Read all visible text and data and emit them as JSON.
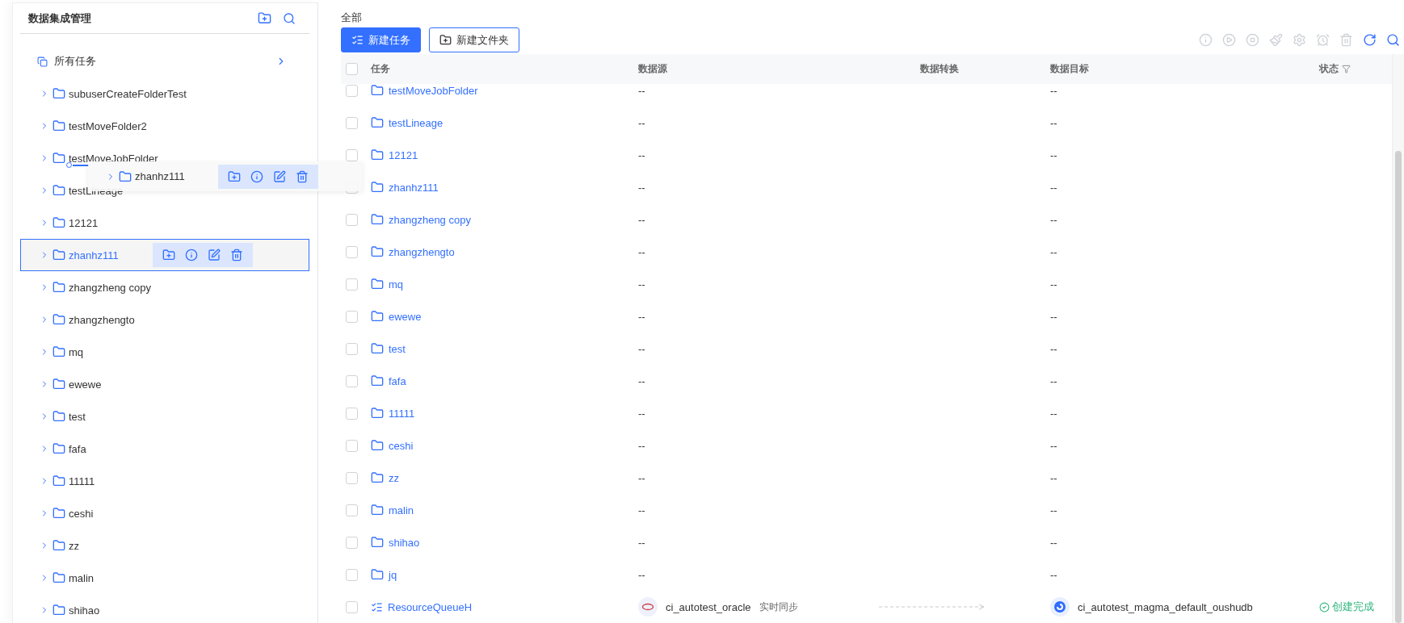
{
  "sidebar": {
    "title": "数据集成管理",
    "all_tasks": {
      "label": "所有任务"
    },
    "items": [
      {
        "label": "subuserCreateFolderTest",
        "selected": false,
        "expanded": false
      },
      {
        "label": "testMoveFolder2",
        "selected": false,
        "expanded": false
      },
      {
        "label": "testMoveJobFolder",
        "selected": false,
        "expanded": false
      },
      {
        "label": "testLineage",
        "selected": false,
        "expanded": false
      },
      {
        "label": "12121",
        "selected": false,
        "expanded": false
      },
      {
        "label": "zhanhz111",
        "selected": true,
        "expanded": false
      },
      {
        "label": "zhangzheng copy",
        "selected": false,
        "expanded": false
      },
      {
        "label": "zhangzhengto",
        "selected": false,
        "expanded": false
      },
      {
        "label": "mq",
        "selected": false,
        "expanded": false
      },
      {
        "label": "ewewe",
        "selected": false,
        "expanded": false
      },
      {
        "label": "test",
        "selected": false,
        "expanded": false
      },
      {
        "label": "fafa",
        "selected": false,
        "expanded": false
      },
      {
        "label": "11111",
        "selected": false,
        "expanded": false
      },
      {
        "label": "ceshi",
        "selected": false,
        "expanded": false
      },
      {
        "label": "zz",
        "selected": false,
        "expanded": false
      },
      {
        "label": "malin",
        "selected": false,
        "expanded": false
      },
      {
        "label": "shihao",
        "selected": false,
        "expanded": false
      }
    ]
  },
  "drag_ghost": {
    "label": "zhanhz111",
    "expanded": false
  },
  "main": {
    "breadcrumb": "全部",
    "buttons": [
      {
        "label": "新建任务",
        "kind": "primary"
      },
      {
        "label": "新建文件夹",
        "kind": "secondary"
      }
    ],
    "toolbar": [
      {
        "disabled": true
      },
      {
        "disabled": true
      },
      {
        "disabled": true
      },
      {
        "disabled": true
      },
      {
        "disabled": true
      },
      {
        "disabled": true
      },
      {
        "disabled": true
      },
      {
        "disabled": false
      },
      {
        "disabled": false
      }
    ]
  },
  "table": {
    "all_checked": false,
    "columns": [
      "任务",
      "数据源",
      "数据转换",
      "数据目标",
      "状态"
    ],
    "rows": [
      {
        "kind": "folder",
        "name": "testMoveJobFolder",
        "checked": false,
        "source": "--",
        "target": "--"
      },
      {
        "kind": "folder",
        "name": "testLineage",
        "checked": false,
        "source": "--",
        "target": "--"
      },
      {
        "kind": "folder",
        "name": "12121",
        "checked": false,
        "source": "--",
        "target": "--"
      },
      {
        "kind": "folder",
        "name": "zhanhz111",
        "checked": false,
        "source": "--",
        "target": "--"
      },
      {
        "kind": "folder",
        "name": "zhangzheng copy",
        "checked": false,
        "source": "--",
        "target": "--"
      },
      {
        "kind": "folder",
        "name": "zhangzhengto",
        "checked": false,
        "source": "--",
        "target": "--"
      },
      {
        "kind": "folder",
        "name": "mq",
        "checked": false,
        "source": "--",
        "target": "--"
      },
      {
        "kind": "folder",
        "name": "ewewe",
        "checked": false,
        "source": "--",
        "target": "--"
      },
      {
        "kind": "folder",
        "name": "test",
        "checked": false,
        "source": "--",
        "target": "--"
      },
      {
        "kind": "folder",
        "name": "fafa",
        "checked": false,
        "source": "--",
        "target": "--"
      },
      {
        "kind": "folder",
        "name": "11111",
        "checked": false,
        "source": "--",
        "target": "--"
      },
      {
        "kind": "folder",
        "name": "ceshi",
        "checked": false,
        "source": "--",
        "target": "--"
      },
      {
        "kind": "folder",
        "name": "zz",
        "checked": false,
        "source": "--",
        "target": "--"
      },
      {
        "kind": "folder",
        "name": "malin",
        "checked": false,
        "source": "--",
        "target": "--"
      },
      {
        "kind": "folder",
        "name": "shihao",
        "checked": false,
        "source": "--",
        "target": "--"
      },
      {
        "kind": "folder",
        "name": "jq",
        "checked": false,
        "source": "--",
        "target": "--"
      },
      {
        "kind": "task",
        "name": "ResourceQueueH",
        "checked": false,
        "source": "ci_autotest_oracle",
        "sync_mode": "实时同步",
        "target": "ci_autotest_magma_default_oushudb",
        "status": "创建完成"
      }
    ]
  }
}
